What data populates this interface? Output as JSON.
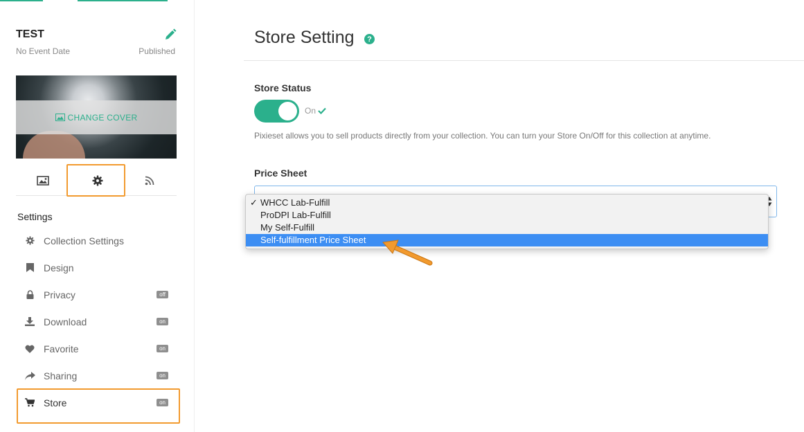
{
  "collection": {
    "title": "TEST",
    "date": "No Event Date",
    "status": "Published",
    "cover_button": "CHANGE COVER"
  },
  "sidebar": {
    "tabs": [
      {
        "icon": "image-icon"
      },
      {
        "icon": "gear-icon",
        "active": true
      },
      {
        "icon": "rss-icon"
      }
    ],
    "settings_heading": "Settings",
    "items": [
      {
        "label": "Collection Settings",
        "icon": "gear-icon",
        "badge": ""
      },
      {
        "label": "Design",
        "icon": "bookmark-icon",
        "badge": ""
      },
      {
        "label": "Privacy",
        "icon": "lock-icon",
        "badge": "off"
      },
      {
        "label": "Download",
        "icon": "download-icon",
        "badge": "on"
      },
      {
        "label": "Favorite",
        "icon": "heart-icon",
        "badge": "on"
      },
      {
        "label": "Sharing",
        "icon": "share-icon",
        "badge": "on"
      },
      {
        "label": "Store",
        "icon": "cart-icon",
        "badge": "on"
      }
    ]
  },
  "main": {
    "title": "Store Setting",
    "help_icon": "?",
    "store_status": {
      "label": "Store Status",
      "toggle_state": "On",
      "description": "Pixieset allows you to sell products directly from your collection. You can turn your Store On/Off for this collection at anytime."
    },
    "price_sheet": {
      "label": "Price Sheet",
      "options": [
        "WHCC Lab-Fulfill",
        "ProDPI Lab-Fulfill",
        "My Self-Fulfill",
        "Self-fulfillment Price Sheet"
      ],
      "checked_option": "WHCC Lab-Fulfill",
      "highlighted_option": "Self-fulfillment Price Sheet",
      "check_mark": "✓"
    }
  },
  "colors": {
    "accent": "#2bb08c",
    "highlight_outline": "#f29a2e",
    "selection": "#3d8ef3"
  }
}
